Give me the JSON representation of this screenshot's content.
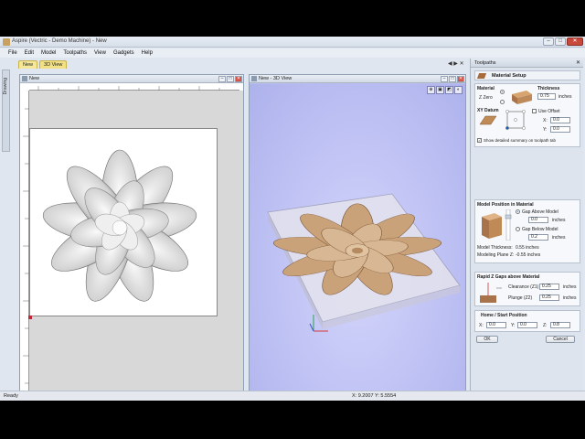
{
  "window": {
    "title": "Aspire (Vectric - Demo Machine) - New",
    "controls": [
      "–",
      "□",
      "✕"
    ]
  },
  "menu": [
    "File",
    "Edit",
    "Model",
    "Toolpaths",
    "View",
    "Gadgets",
    "Help"
  ],
  "tabs": [
    "New",
    "3D View"
  ],
  "nav_arrows": "◀ ▶ ✕",
  "layers_label": "Drawing",
  "view2d": {
    "title": "New"
  },
  "view3d": {
    "title": "New - 3D View"
  },
  "toolpaths": {
    "header": "Toolpaths",
    "pin": "✕",
    "tool_title": "Material Setup",
    "material": {
      "label": "Material",
      "thickness_label": "Thickness",
      "thickness_value": "0.75",
      "units": "inches",
      "zzero_label": "Z Zero"
    },
    "xy_datum": {
      "label": "XY Datum",
      "use_offset_label": "Use Offset",
      "offset_x": "0.0",
      "offset_y": "0.0",
      "x_label": "X:",
      "y_label": "Y:",
      "show_summary_label": "Show detailed summary on toolpath tab"
    },
    "model_position": {
      "label": "Model Position in Material",
      "gap_above_label": "Gap Above Model",
      "gap_above_value": "0.0",
      "gap_below_label": "Gap Below Model",
      "gap_below_value": "0.2",
      "units": "inches",
      "model_thickness_label": "Model Thickness:",
      "model_thickness_value": "0.55 inches",
      "modeling_plane_label": "Modeling Plane Z:",
      "modeling_plane_value": "-0.55 inches"
    },
    "rapid": {
      "label": "Rapid Z Gaps above Material",
      "clearance_label": "Clearance (Z1)",
      "clearance_value": "0.25",
      "plunge_label": "Plunge (Z2)",
      "plunge_value": "0.25",
      "units": "inches"
    },
    "home": {
      "label": "Home / Start Position",
      "x_label": "X:",
      "x_value": "0.0",
      "y_label": "Y:",
      "y_value": "0.0",
      "z_label": "Z:",
      "z_value": "0.8"
    },
    "ok_label": "OK",
    "cancel_label": "Cancel"
  },
  "status": {
    "text": "Ready",
    "coords": "X: 9.2007 Y: 5.5554"
  },
  "colors": {
    "view3d_bg": "#b9bdf2",
    "accent_tab": "#f4e79a",
    "wood": "#c9a27a"
  }
}
